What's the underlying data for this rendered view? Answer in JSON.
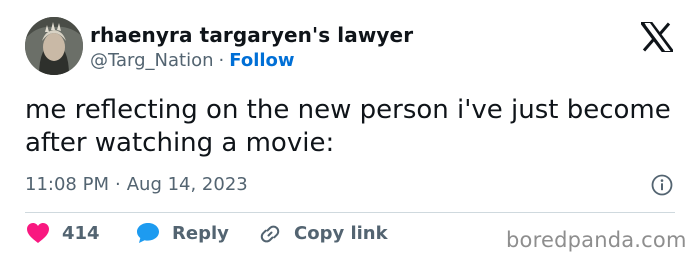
{
  "user": {
    "display_name": "rhaenyra targaryen's lawyer",
    "handle": "@Targ_Nation",
    "separator": "·",
    "follow_label": "Follow",
    "avatar_icon": "profile-photo"
  },
  "platform": {
    "logo_icon": "x-logo-icon"
  },
  "tweet": {
    "text": "me reflecting on the new person i've just become after watching a movie:",
    "time": "11:08 PM",
    "date_separator": "·",
    "date": "Aug 14, 2023",
    "info_icon": "info-icon"
  },
  "actions": {
    "like_count": "414",
    "reply_label": "Reply",
    "copy_link_label": "Copy link"
  },
  "watermark": {
    "text": "boredpanda.com"
  },
  "colors": {
    "text": "#0f1419",
    "muted": "#536471",
    "link": "#006fd6",
    "like": "#f91880",
    "reply": "#1d9bf0",
    "divider": "#cfd9de"
  }
}
